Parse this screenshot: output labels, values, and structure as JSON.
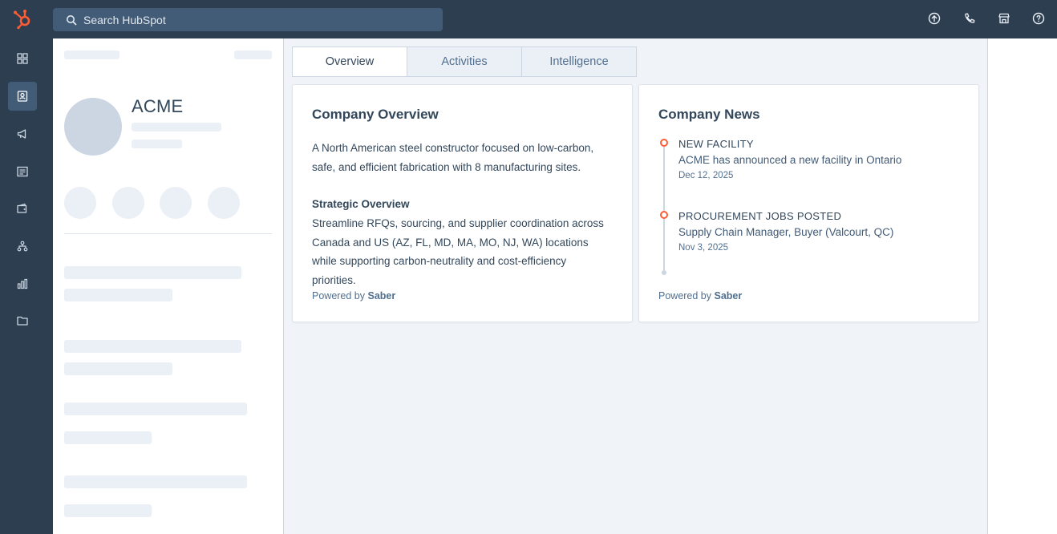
{
  "topbar": {
    "search_placeholder": "Search HubSpot",
    "icons": [
      "upgrade-icon",
      "phone-icon",
      "marketplace-icon",
      "help-icon"
    ]
  },
  "leftnav": {
    "items": [
      "dashboard-icon",
      "contacts-icon",
      "marketing-icon",
      "content-icon",
      "commerce-icon",
      "automation-icon",
      "reports-icon",
      "library-icon"
    ],
    "active_index": 1
  },
  "profile": {
    "company_name": "ACME"
  },
  "tabs": [
    {
      "label": "Overview",
      "active": true
    },
    {
      "label": "Activities",
      "active": false
    },
    {
      "label": "Intelligence",
      "active": false
    }
  ],
  "overview_card": {
    "title": "Company Overview",
    "description": "A North American steel constructor focused on low-carbon, safe, and efficient fabrication with 8 manufacturing sites.",
    "strategic_title": "Strategic Overview",
    "strategic_text": "Streamline RFQs, sourcing, and supplier coordination across Canada and US (AZ, FL, MD, MA, MO, NJ, WA) locations while supporting carbon-neutrality and cost-efficiency priorities.",
    "powered_prefix": "Powered by",
    "powered_brand": "Saber"
  },
  "news_card": {
    "title": "Company News",
    "items": [
      {
        "heading": "NEW FACILITY",
        "description": "ACME has announced a new facility in Ontario",
        "date": "Dec 12, 2025"
      },
      {
        "heading": "PROCUREMENT JOBS POSTED",
        "description": "Supply Chain Manager, Buyer (Valcourt, QC)",
        "date": "Nov 3, 2025"
      }
    ],
    "powered_prefix": "Powered by",
    "powered_brand": "Saber"
  },
  "colors": {
    "nav_bg": "#2d3e50",
    "search_bg": "#425b76",
    "accent": "#ff5c35",
    "text": "#33475b",
    "panel_bg": "#f0f4f8"
  }
}
